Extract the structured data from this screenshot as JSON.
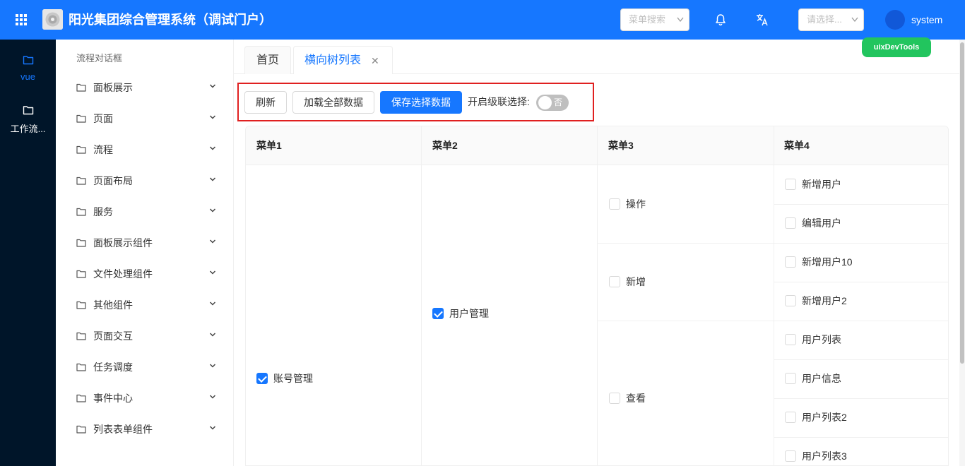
{
  "header": {
    "title": "阳光集团综合管理系统（调试门户）",
    "menu_search_placeholder": "菜单搜索",
    "lang_select_placeholder": "请选择...",
    "username": "system",
    "dev_badge": "uixDevTools"
  },
  "rail": {
    "items": [
      {
        "label": "vue",
        "active": true
      },
      {
        "label": "工作流..."
      }
    ]
  },
  "sidebar": {
    "header": "流程对话框",
    "items": [
      {
        "label": "面板展示"
      },
      {
        "label": "页面"
      },
      {
        "label": "流程"
      },
      {
        "label": "页面布局"
      },
      {
        "label": "服务"
      },
      {
        "label": "面板展示组件"
      },
      {
        "label": "文件处理组件"
      },
      {
        "label": "其他组件"
      },
      {
        "label": "页面交互"
      },
      {
        "label": "任务调度"
      },
      {
        "label": "事件中心"
      },
      {
        "label": "列表表单组件"
      }
    ]
  },
  "tabs": [
    {
      "label": "首页"
    },
    {
      "label": "横向树列表",
      "active": true
    }
  ],
  "toolbar": {
    "refresh_label": "刷新",
    "load_all_label": "加载全部数据",
    "save_selection_label": "保存选择数据",
    "cascade_label": "开启级联选择:",
    "cascade_switch_text": "否",
    "cascade_enabled": false
  },
  "table": {
    "columns": [
      "菜单1",
      "菜单2",
      "菜单3",
      "菜单4"
    ],
    "menu1": [
      {
        "label": "账号管理",
        "checked": true
      }
    ],
    "menu2": [
      {
        "label": "用户管理",
        "checked": true
      }
    ],
    "menu3": [
      {
        "label": "操作",
        "checked": false
      },
      {
        "label": "新增",
        "checked": false
      },
      {
        "label": "查看",
        "checked": false
      }
    ],
    "menu4": [
      {
        "label": "新增用户",
        "checked": false
      },
      {
        "label": "编辑用户",
        "checked": false
      },
      {
        "label": "新增用户10",
        "checked": false
      },
      {
        "label": "新增用户2",
        "checked": false
      },
      {
        "label": "用户列表",
        "checked": false
      },
      {
        "label": "用户信息",
        "checked": false
      },
      {
        "label": "用户列表2",
        "checked": false
      },
      {
        "label": "用户列表3",
        "checked": false
      }
    ]
  },
  "colors": {
    "primary": "#1677ff",
    "rail_bg": "#001529",
    "dev_badge": "#22c55e",
    "highlight_frame": "#e02020"
  }
}
